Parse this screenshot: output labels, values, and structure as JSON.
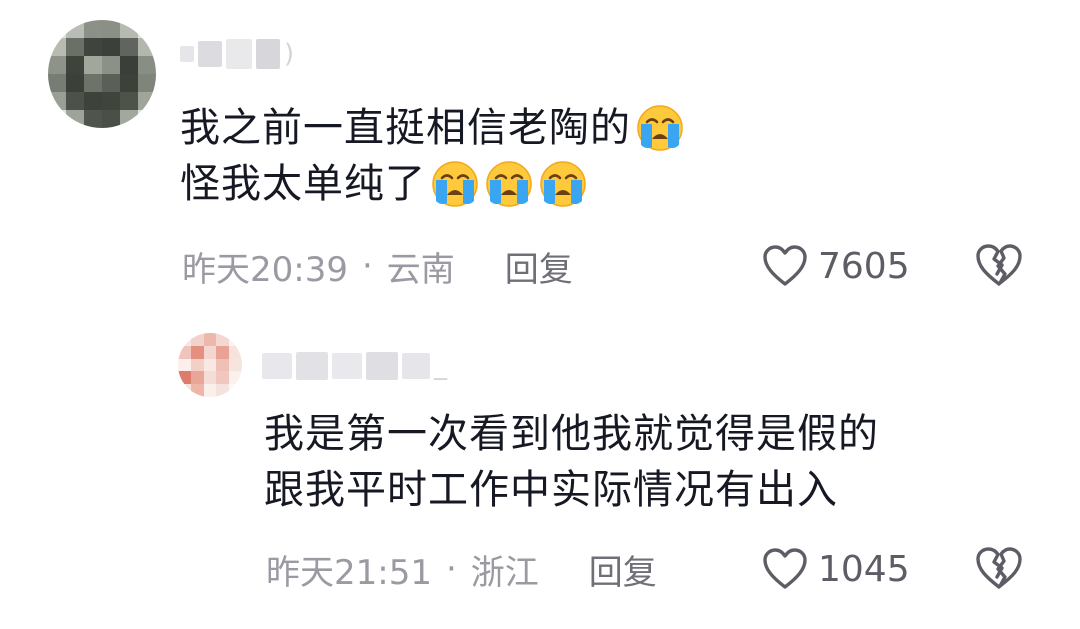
{
  "comment": {
    "text_line1": "我之前一直挺相信老陶的",
    "text_line2": "怪我太单纯了",
    "time": "昨天20:39",
    "separator": "·",
    "location": "云南",
    "reply_label": "回复",
    "like_count": "7605",
    "emoji_name": "crying-face",
    "reply": {
      "text_line1": "我是第一次看到他我就觉得是假的",
      "text_line2": "跟我平时工作中实际情况有出入",
      "time": "昨天21:51",
      "separator": "·",
      "location": "浙江",
      "reply_label": "回复",
      "like_count": "1045"
    }
  },
  "colors": {
    "text": "#161823",
    "meta": "#9a9aa3",
    "icon": "#5d5d66",
    "emoji_face": "#ffc93c",
    "emoji_tears": "#3aa6f2"
  }
}
